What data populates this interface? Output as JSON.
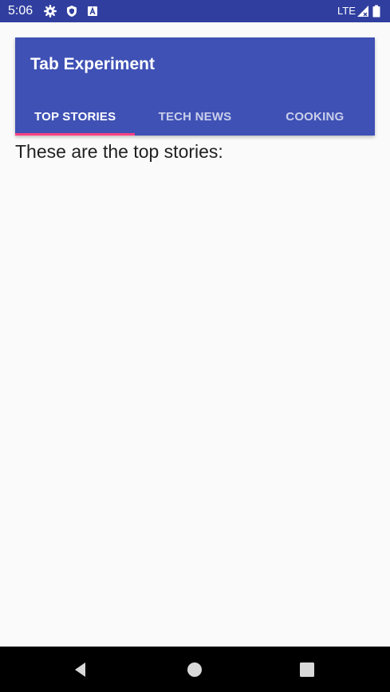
{
  "status_bar": {
    "time": "5:06",
    "network": "LTE",
    "icons": [
      "gear-icon",
      "shield-icon",
      "a-box-icon",
      "signal-icon",
      "battery-icon"
    ]
  },
  "app_bar": {
    "title": "Tab Experiment",
    "background_color": "#3f51b5",
    "tabs": [
      {
        "label": "TOP STORIES",
        "active": true
      },
      {
        "label": "TECH NEWS",
        "active": false
      },
      {
        "label": "COOKING",
        "active": false
      }
    ],
    "indicator_color": "#ff4081"
  },
  "content": {
    "text": "These are the top stories:"
  },
  "navigation_bar": {
    "buttons": [
      "back-icon",
      "home-icon",
      "recents-icon"
    ]
  }
}
